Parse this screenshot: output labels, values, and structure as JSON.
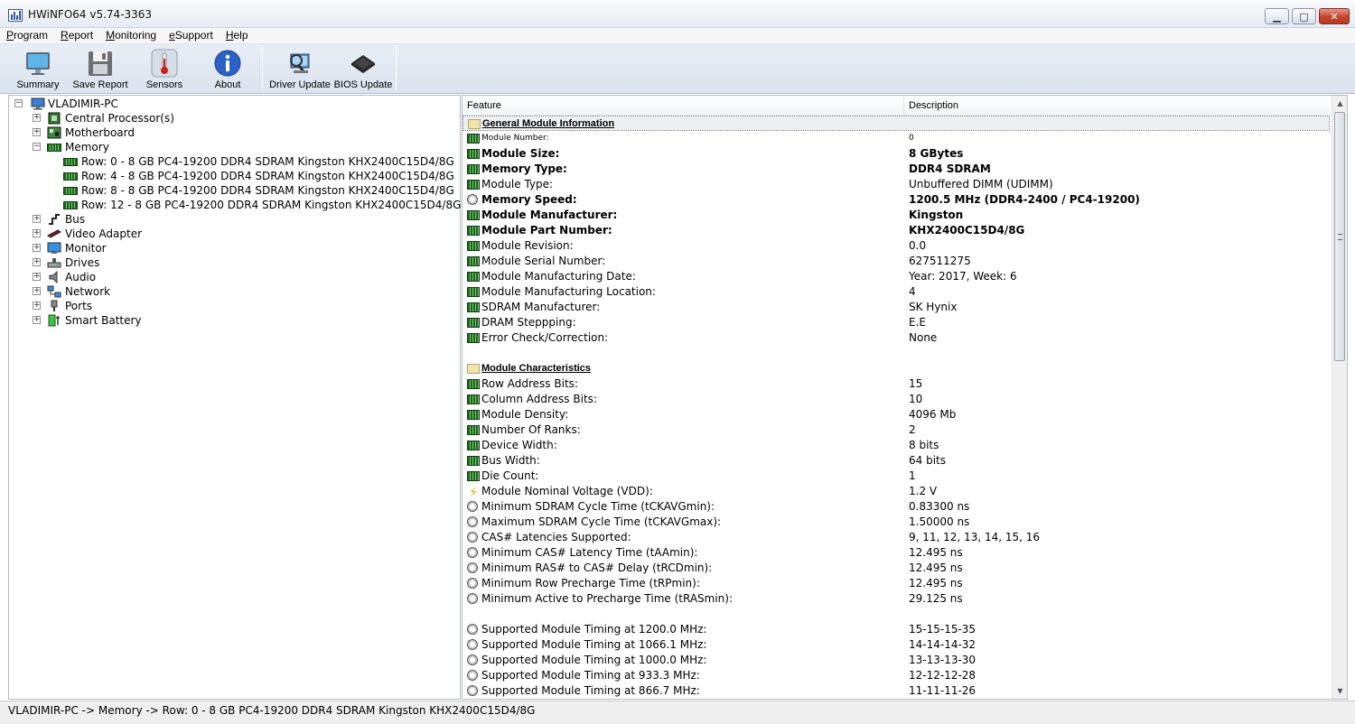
{
  "window": {
    "title": "HWiNFO64 v5.74-3363",
    "min": "▁",
    "max": "□",
    "close": "✕"
  },
  "menu": [
    "Program",
    "Report",
    "Monitoring",
    "eSupport",
    "Help"
  ],
  "toolbar": {
    "summary": "Summary",
    "save_report": "Save Report",
    "sensors": "Sensors",
    "about": "About",
    "driver_update": "Driver Update",
    "bios_update": "BIOS Update"
  },
  "tree": {
    "root": "VLADIMIR-PC",
    "cpu": "Central Processor(s)",
    "motherboard": "Motherboard",
    "memory": "Memory",
    "rows": [
      "Row: 0 - 8 GB PC4-19200 DDR4 SDRAM Kingston KHX2400C15D4/8G",
      "Row: 4 - 8 GB PC4-19200 DDR4 SDRAM Kingston KHX2400C15D4/8G",
      "Row: 8 - 8 GB PC4-19200 DDR4 SDRAM Kingston KHX2400C15D4/8G",
      "Row: 12 - 8 GB PC4-19200 DDR4 SDRAM Kingston KHX2400C15D4/8G"
    ],
    "bus": "Bus",
    "video": "Video Adapter",
    "monitor": "Monitor",
    "drives": "Drives",
    "audio": "Audio",
    "network": "Network",
    "ports": "Ports",
    "battery": "Smart Battery"
  },
  "table": {
    "col_feature": "Feature",
    "col_description": "Description",
    "rows": [
      {
        "f": "General Module Information",
        "d": "",
        "kind": "section"
      },
      {
        "f": "Module Number:",
        "d": "0",
        "kind": "small"
      },
      {
        "f": "Module Size:",
        "d": "8 GBytes",
        "kind": "bold"
      },
      {
        "f": "Memory Type:",
        "d": "DDR4 SDRAM",
        "kind": "bold"
      },
      {
        "f": "Module Type:",
        "d": "Unbuffered DIMM (UDIMM)",
        "kind": "normal"
      },
      {
        "f": "Memory Speed:",
        "d": "1200.5 MHz (DDR4-2400 / PC4-19200)",
        "kind": "bold",
        "icon": "clock"
      },
      {
        "f": "Module Manufacturer:",
        "d": "Kingston",
        "kind": "bold"
      },
      {
        "f": "Module Part Number:",
        "d": "KHX2400C15D4/8G",
        "kind": "bold"
      },
      {
        "f": "Module Revision:",
        "d": "0.0",
        "kind": "normal"
      },
      {
        "f": "Module Serial Number:",
        "d": "627511275",
        "kind": "normal"
      },
      {
        "f": "Module Manufacturing Date:",
        "d": "Year: 2017, Week: 6",
        "kind": "normal"
      },
      {
        "f": "Module Manufacturing Location:",
        "d": "4",
        "kind": "normal"
      },
      {
        "f": "SDRAM Manufacturer:",
        "d": "SK Hynix",
        "kind": "normal"
      },
      {
        "f": "DRAM Steppping:",
        "d": "E.E",
        "kind": "normal"
      },
      {
        "f": "Error Check/Correction:",
        "d": "None",
        "kind": "normal"
      },
      {
        "f": "",
        "d": "",
        "kind": "blank"
      },
      {
        "f": "Module Characteristics",
        "d": "",
        "kind": "section2"
      },
      {
        "f": "Row Address Bits:",
        "d": "15",
        "kind": "normal"
      },
      {
        "f": "Column Address Bits:",
        "d": "10",
        "kind": "normal"
      },
      {
        "f": "Module Density:",
        "d": "4096 Mb",
        "kind": "normal"
      },
      {
        "f": "Number Of Ranks:",
        "d": "2",
        "kind": "normal"
      },
      {
        "f": "Device Width:",
        "d": "8 bits",
        "kind": "normal"
      },
      {
        "f": "Bus Width:",
        "d": "64 bits",
        "kind": "normal"
      },
      {
        "f": "Die Count:",
        "d": "1",
        "kind": "normal"
      },
      {
        "f": "Module Nominal Voltage (VDD):",
        "d": "1.2 V",
        "kind": "normal",
        "icon": "bolt"
      },
      {
        "f": "Minimum SDRAM Cycle Time (tCKAVGmin):",
        "d": "0.83300 ns",
        "kind": "normal",
        "icon": "clock"
      },
      {
        "f": "Maximum SDRAM Cycle Time (tCKAVGmax):",
        "d": "1.50000 ns",
        "kind": "normal",
        "icon": "clock"
      },
      {
        "f": "CAS# Latencies Supported:",
        "d": "9, 11, 12, 13, 14, 15, 16",
        "kind": "normal",
        "icon": "clock"
      },
      {
        "f": "Minimum CAS# Latency Time (tAAmin):",
        "d": "12.495 ns",
        "kind": "normal",
        "icon": "clock"
      },
      {
        "f": "Minimum RAS# to CAS# Delay (tRCDmin):",
        "d": "12.495 ns",
        "kind": "normal",
        "icon": "clock"
      },
      {
        "f": "Minimum Row Precharge Time (tRPmin):",
        "d": "12.495 ns",
        "kind": "normal",
        "icon": "clock"
      },
      {
        "f": "Minimum Active to Precharge Time (tRASmin):",
        "d": "29.125 ns",
        "kind": "normal",
        "icon": "clock"
      },
      {
        "f": "",
        "d": "",
        "kind": "blank"
      },
      {
        "f": "Supported Module Timing at 1200.0 MHz:",
        "d": "15-15-15-35",
        "kind": "normal",
        "icon": "clock"
      },
      {
        "f": "Supported Module Timing at 1066.1 MHz:",
        "d": "14-14-14-32",
        "kind": "normal",
        "icon": "clock"
      },
      {
        "f": "Supported Module Timing at 1000.0 MHz:",
        "d": "13-13-13-30",
        "kind": "normal",
        "icon": "clock"
      },
      {
        "f": "Supported Module Timing at 933.3 MHz:",
        "d": "12-12-12-28",
        "kind": "normal",
        "icon": "clock"
      },
      {
        "f": "Supported Module Timing at 866.7 MHz:",
        "d": "11-11-11-26",
        "kind": "normal",
        "icon": "clock"
      }
    ]
  },
  "status": "VLADIMIR-PC -> Memory -> Row: 0 - 8 GB PC4-19200 DDR4 SDRAM Kingston KHX2400C15D4/8G",
  "scrollbar": {
    "up": "▲",
    "down": "▼"
  },
  "tree_expanders": {
    "expanded": "−",
    "collapsed": "+"
  }
}
